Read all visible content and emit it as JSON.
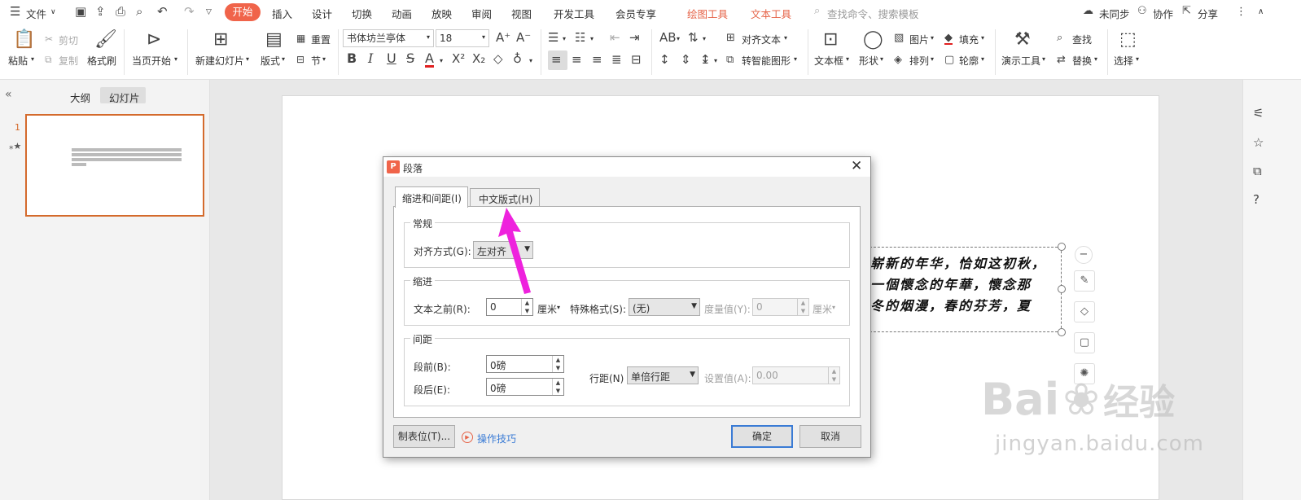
{
  "menubar": {
    "file": "文件",
    "tabs": [
      "开始",
      "插入",
      "设计",
      "切换",
      "动画",
      "放映",
      "审阅",
      "视图",
      "开发工具",
      "会员专享",
      "绘图工具",
      "文本工具"
    ],
    "search": "查找命令、搜索模板",
    "unsynced": "未同步",
    "collab": "协作",
    "share": "分享"
  },
  "ribbon": {
    "paste": "粘贴",
    "cut": "剪切",
    "copy": "复制",
    "format_painter": "格式刷",
    "from_current": "当页开始",
    "new_slide": "新建幻灯片",
    "layout": "版式",
    "reset": "重置",
    "section": "节",
    "font_name": "书体坊兰亭体",
    "font_size": "18",
    "align_text": "对齐文本",
    "smart_shape": "转智能图形",
    "textbox": "文本框",
    "shape": "形状",
    "picture": "图片",
    "arrange": "排列",
    "fill": "填充",
    "outline": "轮廓",
    "present_tools": "演示工具",
    "find": "查找",
    "replace": "替换",
    "select": "选择"
  },
  "sidebar": {
    "tab_outline": "大纲",
    "tab_slides": "幻灯片",
    "slide_number": "1"
  },
  "slide": {
    "lines": [
      "崭新的年华，恰如这初秋，",
      "一個懷念的年華，懷念那",
      "冬的烟漫，春的芬芳，夏"
    ]
  },
  "dialog": {
    "title": "段落",
    "tab_indent": "缩进和间距(I)",
    "tab_chinese": "中文版式(H)",
    "grp_general": "常规",
    "align_label": "对齐方式(G):",
    "align_value": "左对齐",
    "grp_indent": "缩进",
    "before_text_label": "文本之前(R):",
    "before_text_value": "0",
    "unit": "厘米",
    "special_label": "特殊格式(S):",
    "special_value": "(无)",
    "measure_label": "度量值(Y):",
    "measure_value": "0",
    "grp_spacing": "间距",
    "before_label": "段前(B):",
    "before_value": "0磅",
    "after_label": "段后(E):",
    "after_value": "0磅",
    "line_spacing_label": "行距(N)",
    "line_spacing_value": "单倍行距",
    "set_value_label": "设置值(A):",
    "set_value": "0.00",
    "tabs_button": "制表位(T)...",
    "tips": "操作技巧",
    "ok": "确定",
    "cancel": "取消"
  },
  "watermark": {
    "brand": "Bai",
    "brand_cn": "经验",
    "url": "jingyan.baidu.com"
  },
  "colors": {
    "accent": "#f0644a",
    "arrow": "#ee22dd",
    "selected_thumb": "#d46a2c"
  }
}
